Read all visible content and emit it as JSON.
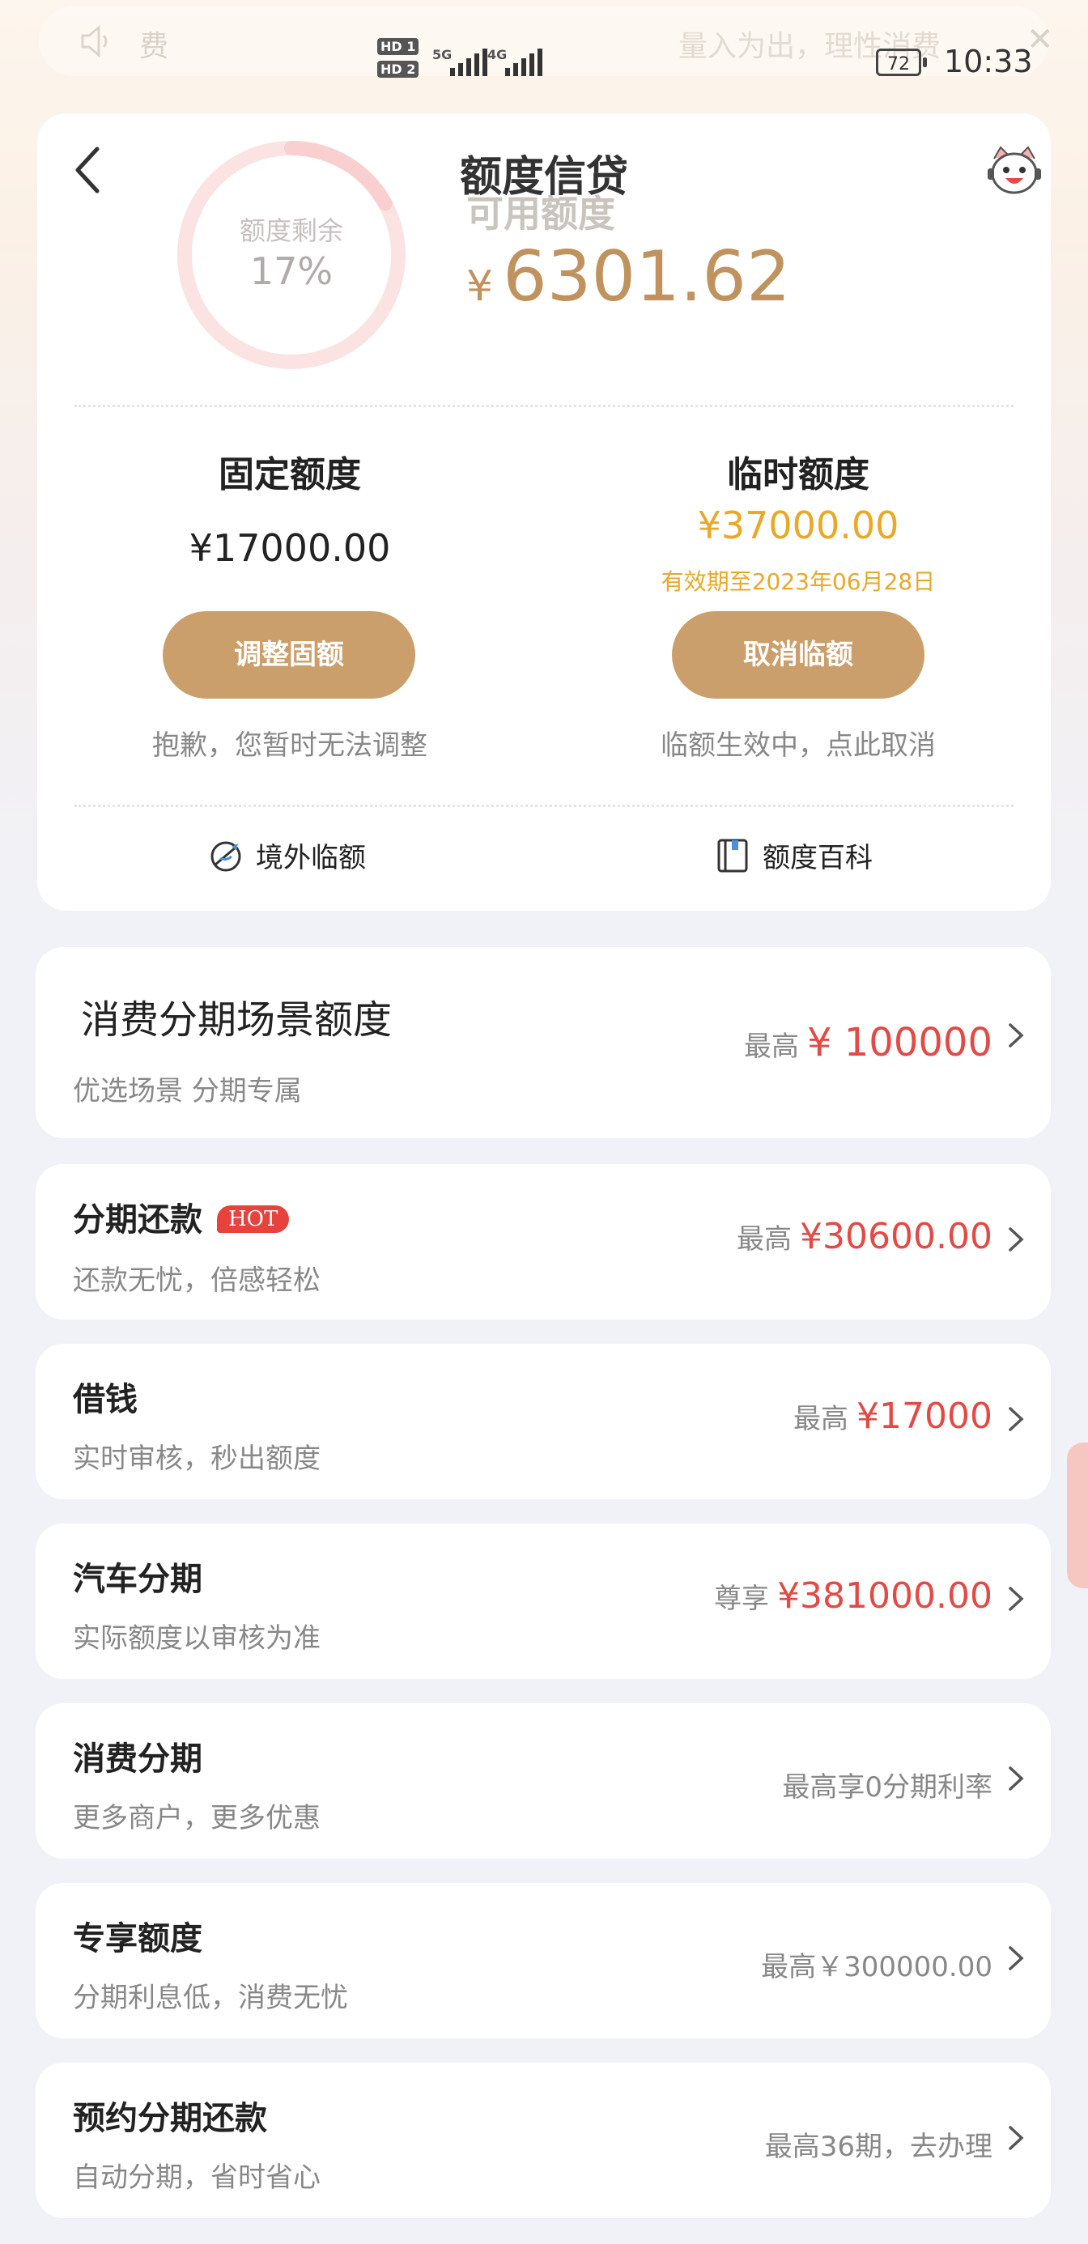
{
  "notice": {
    "left_text": "费",
    "right_text": "量入为出，理性消费"
  },
  "status": {
    "battery": "72",
    "time": "10:33",
    "net1": "5G",
    "net2": "4G",
    "sim1": "HD 1",
    "sim2": "HD 2"
  },
  "header": {
    "title": "额度信贷"
  },
  "summary": {
    "ring_label": "额度剩余",
    "ring_percent": "17%",
    "ring_fraction": 0.17,
    "available_label": "可用额度",
    "available_currency": "¥",
    "available_amount": "6301.62",
    "fixed": {
      "title": "固定额度",
      "amount": "¥17000.00",
      "button": "调整固额",
      "note": "抱歉，您暂时无法调整"
    },
    "temp": {
      "title": "临时额度",
      "amount": "¥37000.00",
      "expiry": "有效期至2023年06月28日",
      "button": "取消临额",
      "note": "临额生效中，点此取消"
    },
    "links": {
      "overseas": "境外临额",
      "wiki": "额度百科"
    }
  },
  "items": [
    {
      "title": "消费分期场景额度",
      "sub": "优选场景 分期专属",
      "prefix": "最高",
      "amount": "¥ 100000"
    },
    {
      "title": "分期还款",
      "badge": "HOT",
      "sub": "还款无忧，倍感轻松",
      "prefix": "最高",
      "amount": "¥30600.00"
    },
    {
      "title": "借钱",
      "sub": "实时审核，秒出额度",
      "prefix": "最高",
      "amount": "¥17000"
    },
    {
      "title": "汽车分期",
      "sub": "实际额度以审核为准",
      "prefix": "尊享",
      "amount": "¥381000.00"
    },
    {
      "title": "消费分期",
      "sub": "更多商户，更多优惠",
      "text": "最高享0分期利率"
    },
    {
      "title": "专享额度",
      "sub": "分期利息低，消费无忧",
      "text": "最高￥300000.00"
    },
    {
      "title": "预约分期还款",
      "sub": "自动分期，省时省心",
      "text": "最高36期，去办理"
    }
  ],
  "colors": {
    "gold": "#cb9f6b",
    "amount_red": "#e34a45",
    "temp_yellow": "#e9a826"
  }
}
